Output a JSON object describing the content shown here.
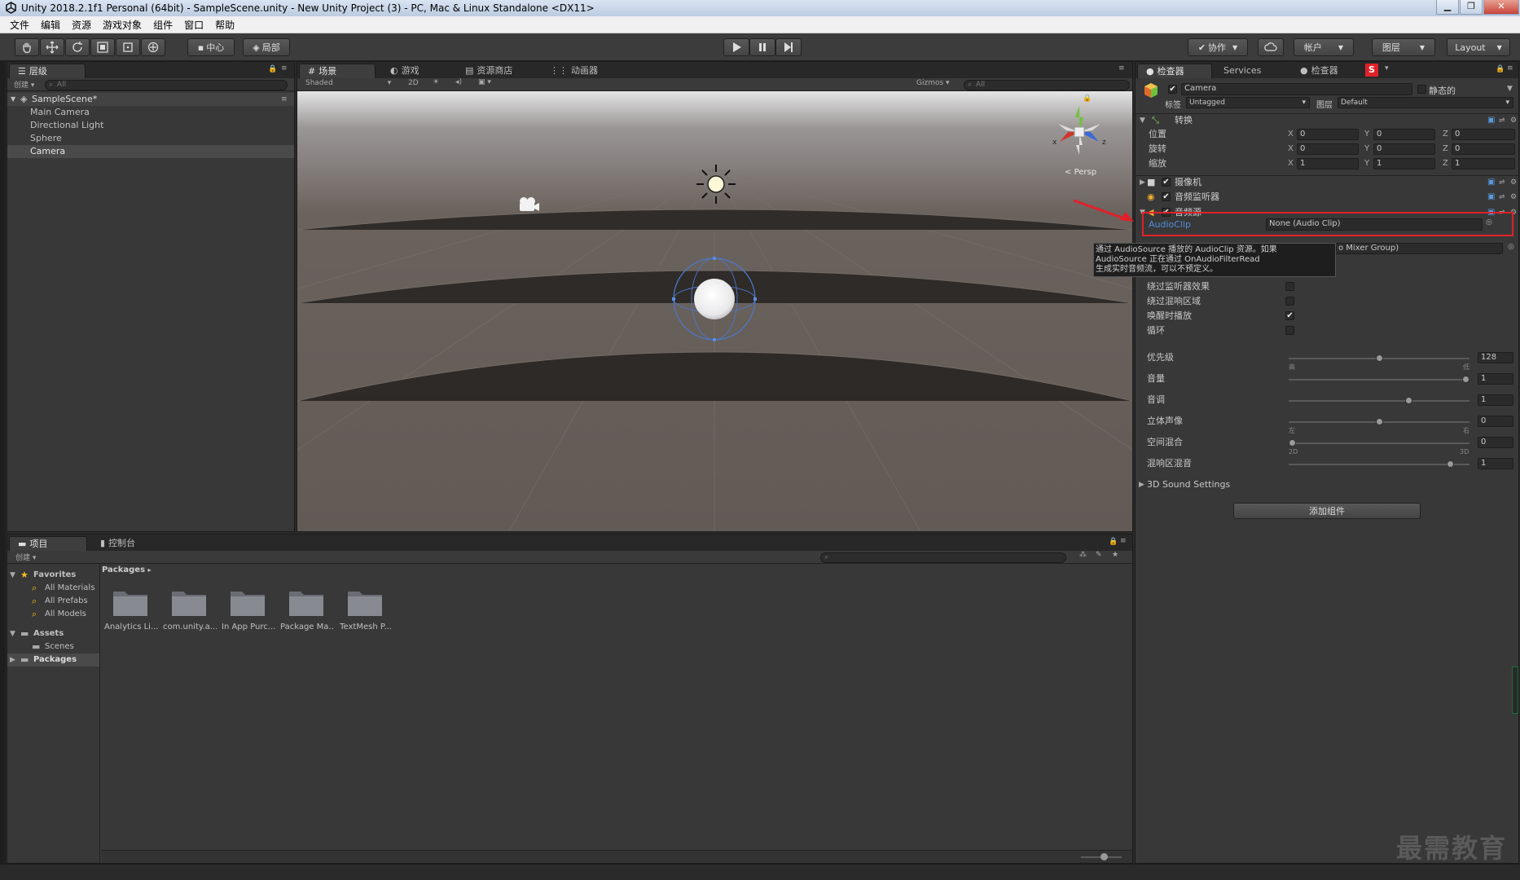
{
  "window": {
    "title": "Unity 2018.2.1f1 Personal (64bit) - SampleScene.unity - New Unity Project (3) - PC, Mac & Linux Standalone <DX11>",
    "minimize": "▁",
    "maximize": "❐",
    "close": "✕"
  },
  "menu": [
    "文件",
    "编辑",
    "资源",
    "游戏对象",
    "组件",
    "窗口",
    "帮助"
  ],
  "toolbar": {
    "pivot": "中心",
    "local": "局部",
    "collab": "协作",
    "account": "帐户",
    "layers": "图层",
    "layout": "Layout"
  },
  "hierarchy": {
    "tab": "层级",
    "create": "创建",
    "search_placeholder": "All",
    "scene": "SampleScene*",
    "items": [
      "Main Camera",
      "Directional Light",
      "Sphere",
      "Camera"
    ]
  },
  "scene": {
    "tabs": [
      "场景",
      "游戏",
      "资源商店",
      "动画器"
    ],
    "shading": "Shaded",
    "mode_2d": "2D",
    "gizmos": "Gizmos",
    "search_placeholder": "All",
    "persp": "Persp",
    "axis_x": "x",
    "axis_z": "z"
  },
  "inspector": {
    "tabs": [
      "检查器",
      "Services",
      "检查器"
    ],
    "object_name": "Camera",
    "static_label": "静态的",
    "tag_label": "标签",
    "tag_value": "Untagged",
    "layer_label": "图层",
    "layer_value": "Default",
    "transform": {
      "title": "转换",
      "rows": [
        {
          "label": "位置",
          "x": "0",
          "y": "0",
          "z": "0"
        },
        {
          "label": "旋转",
          "x": "0",
          "y": "0",
          "z": "0"
        },
        {
          "label": "缩放",
          "x": "1",
          "y": "1",
          "z": "1"
        }
      ],
      "x": "X",
      "y": "Y",
      "z": "Z"
    },
    "components": [
      "摄像机",
      "音频监听器",
      "音频源"
    ],
    "audio": {
      "clip_label": "AudioClip",
      "clip_value": "None (Audio Clip)",
      "output_value": "o Mixer Group)",
      "tooltip": [
        "通过 AudioSource 播放的 AudioClip 资源。如果",
        "AudioSource 正在通过 OnAudioFilterRead",
        "生成实时音频流，可以不预定义。"
      ],
      "checks": [
        {
          "label": "绕过监听器效果",
          "checked": false
        },
        {
          "label": "绕过混响区域",
          "checked": false
        },
        {
          "label": "唤醒时播放",
          "checked": true
        },
        {
          "label": "循环",
          "checked": false
        }
      ],
      "sliders": [
        {
          "label": "优先级",
          "value": "128",
          "fraction": 0.5,
          "left": "高",
          "right": "低"
        },
        {
          "label": "音量",
          "value": "1",
          "fraction": 1.0
        },
        {
          "label": "音调",
          "value": "1",
          "fraction": 0.67
        },
        {
          "label": "立体声像",
          "value": "0",
          "fraction": 0.5,
          "left": "左",
          "right": "右"
        },
        {
          "label": "空间混合",
          "value": "0",
          "fraction": 0.0,
          "left": "2D",
          "right": "3D"
        },
        {
          "label": "混响区混音",
          "value": "1",
          "fraction": 0.91
        }
      ],
      "sound_settings": "3D Sound Settings"
    },
    "add_component": "添加组件"
  },
  "project": {
    "tabs": [
      "项目",
      "控制台"
    ],
    "create": "创建",
    "tree": {
      "favorites": "Favorites",
      "fav_items": [
        "All Materials",
        "All Prefabs",
        "All Models"
      ],
      "assets": "Assets",
      "asset_items": [
        "Scenes"
      ],
      "packages": "Packages"
    },
    "breadcrumb": "Packages",
    "folders": [
      "Analytics Li...",
      "com.unity.a...",
      "In App Purc...",
      "Package Ma...",
      "TextMesh P..."
    ]
  },
  "watermark": "最需教育",
  "colors": {
    "highlight": "#e0212a",
    "link_blue": "#4f8fdb",
    "panel": "#383838",
    "background": "#2a2a2a"
  }
}
